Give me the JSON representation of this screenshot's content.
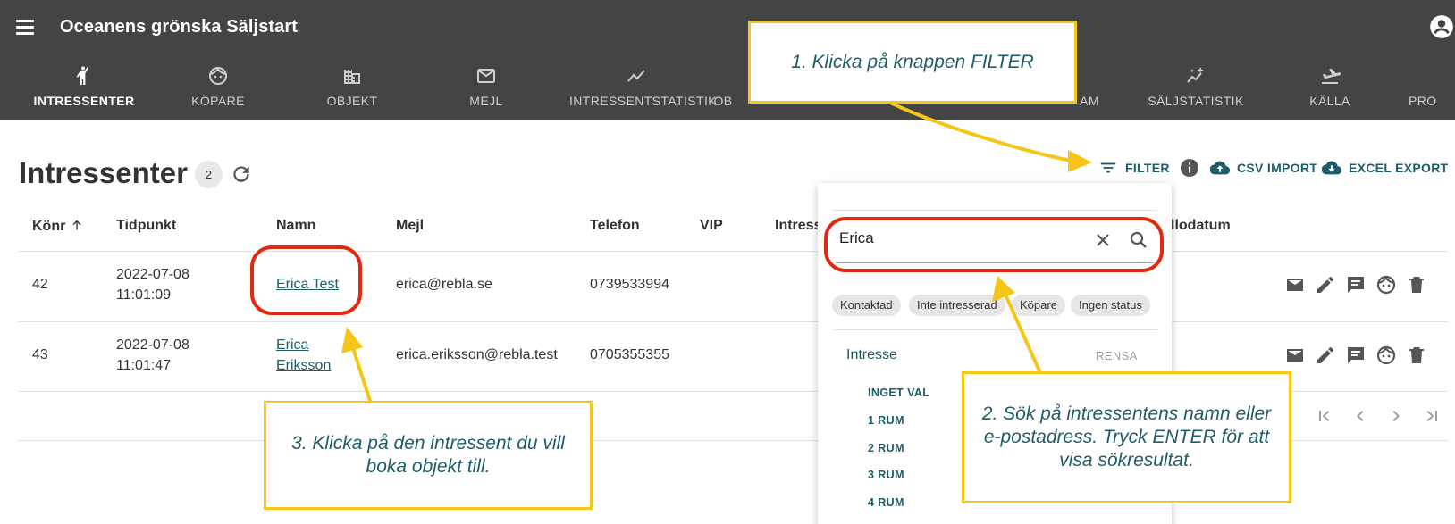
{
  "app": {
    "title": "Oceanens grönska Säljstart"
  },
  "nav": {
    "tabs": [
      {
        "label": "INTRESSENTER",
        "icon": "person-raised-hand-icon",
        "active": true
      },
      {
        "label": "KÖPARE",
        "icon": "face-icon"
      },
      {
        "label": "OBJEKT",
        "icon": "building-icon"
      },
      {
        "label": "MEJL",
        "icon": "mail-icon"
      },
      {
        "label": "INTRESSENTSTATISTIK",
        "icon": "trend-icon"
      },
      {
        "label": "OB",
        "icon": ""
      },
      {
        "label": "AM",
        "icon": ""
      },
      {
        "label": "SÄLJSTATISTIK",
        "icon": "sparkle-chart-icon"
      },
      {
        "label": "KÄLLA",
        "icon": "flight-land-icon"
      },
      {
        "label": "PRO",
        "icon": ""
      }
    ]
  },
  "page": {
    "title": "Intressenter",
    "count": "2"
  },
  "toolbar": {
    "filter": "FILTER",
    "csv_import": "CSV IMPORT",
    "excel_export": "EXCEL EXPORT"
  },
  "table": {
    "headers": {
      "konr": "Könr",
      "tidpunkt": "Tidpunkt",
      "namn": "Namn",
      "mejl": "Mejl",
      "telefon": "Telefon",
      "vip": "VIP",
      "intresse": "Intress",
      "datum": "llodatum"
    },
    "rows": [
      {
        "konr": "42",
        "date": "2022-07-08",
        "time": "11:01:09",
        "name1": "Erica Test",
        "name2": "",
        "email": "erica@rebla.se",
        "phone": "0739533994"
      },
      {
        "konr": "43",
        "date": "2022-07-08",
        "time": "11:01:47",
        "name1": "Erica",
        "name2": "Eriksson",
        "email": "erica.eriksson@rebla.test",
        "phone": "0705355355"
      }
    ]
  },
  "filter_panel": {
    "search_value": "Erica",
    "chips": [
      "Kontaktad",
      "Inte intresserad",
      "Köpare",
      "Ingen status"
    ],
    "section_title": "Intresse",
    "reset": "RENSA",
    "options": [
      "INGET VAL",
      "1 RUM",
      "2 RUM",
      "3 RUM",
      "4 RUM"
    ]
  },
  "callouts": {
    "step1": "1. Klicka på knappen FILTER",
    "step2": "2. Sök på intressentens namn eller e-postadress. Tryck ENTER för att visa sökresultat.",
    "step3": "3. Klicka på den intressent du vill boka objekt till."
  },
  "colors": {
    "appbar": "#444444",
    "accent": "#1f5c69",
    "highlight_ring": "#e02a10",
    "callout_border": "#f5c518"
  }
}
